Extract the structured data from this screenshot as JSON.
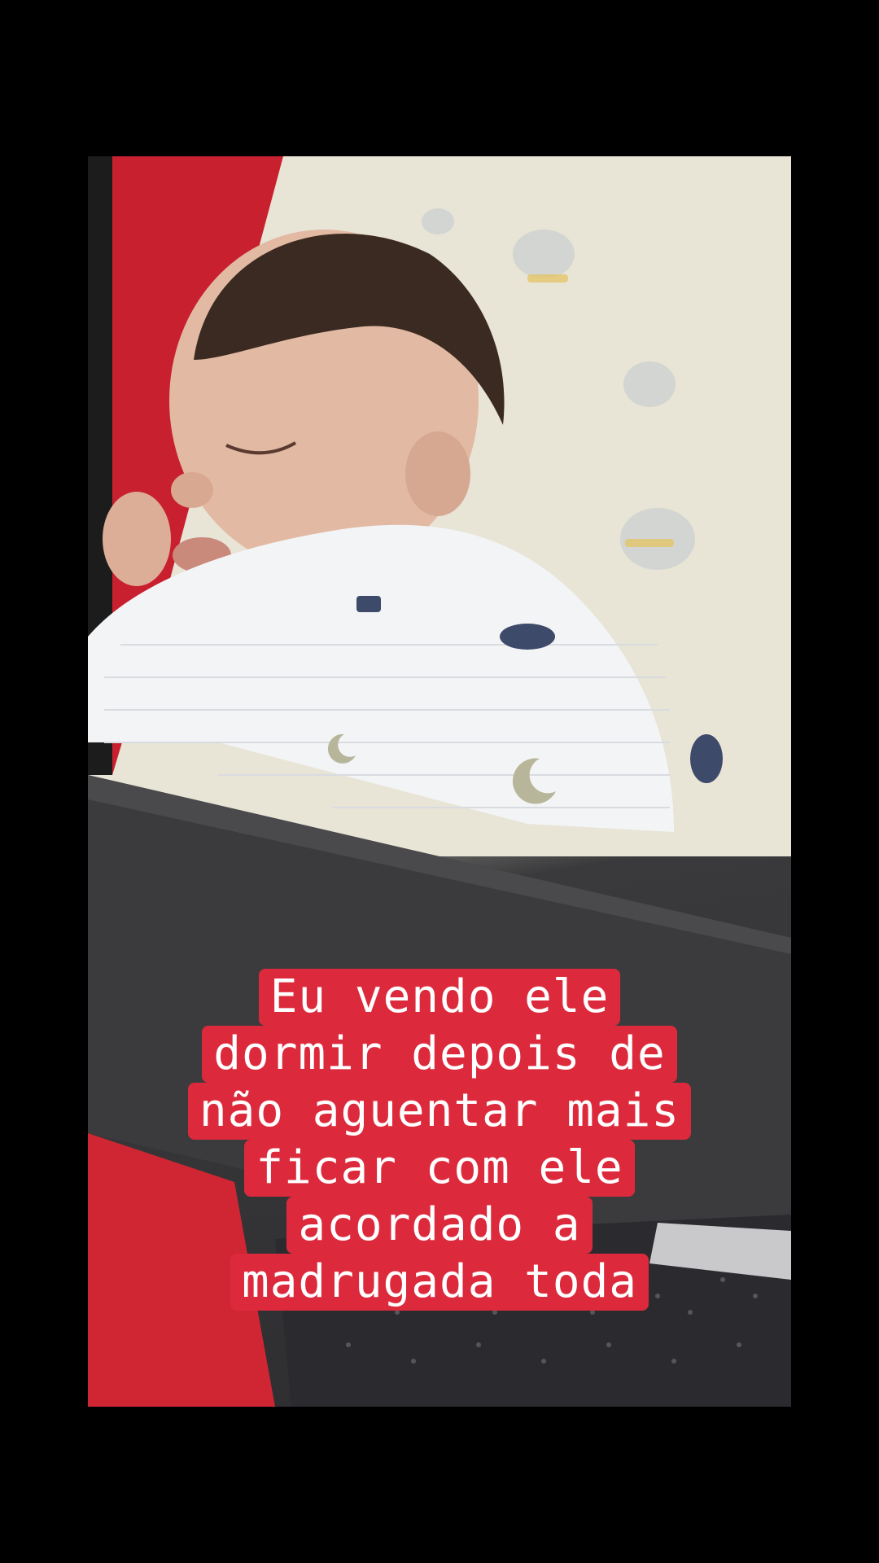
{
  "story": {
    "caption_lines": [
      "Eu vendo ele",
      "dormir depois de",
      "não aguentar mais",
      "ficar com ele",
      "acordado a",
      "madrugada toda"
    ],
    "caption_background": "#dc2a3c",
    "caption_text_color": "#ffffff",
    "photo_description_icon": "sleeping-baby-photo"
  }
}
